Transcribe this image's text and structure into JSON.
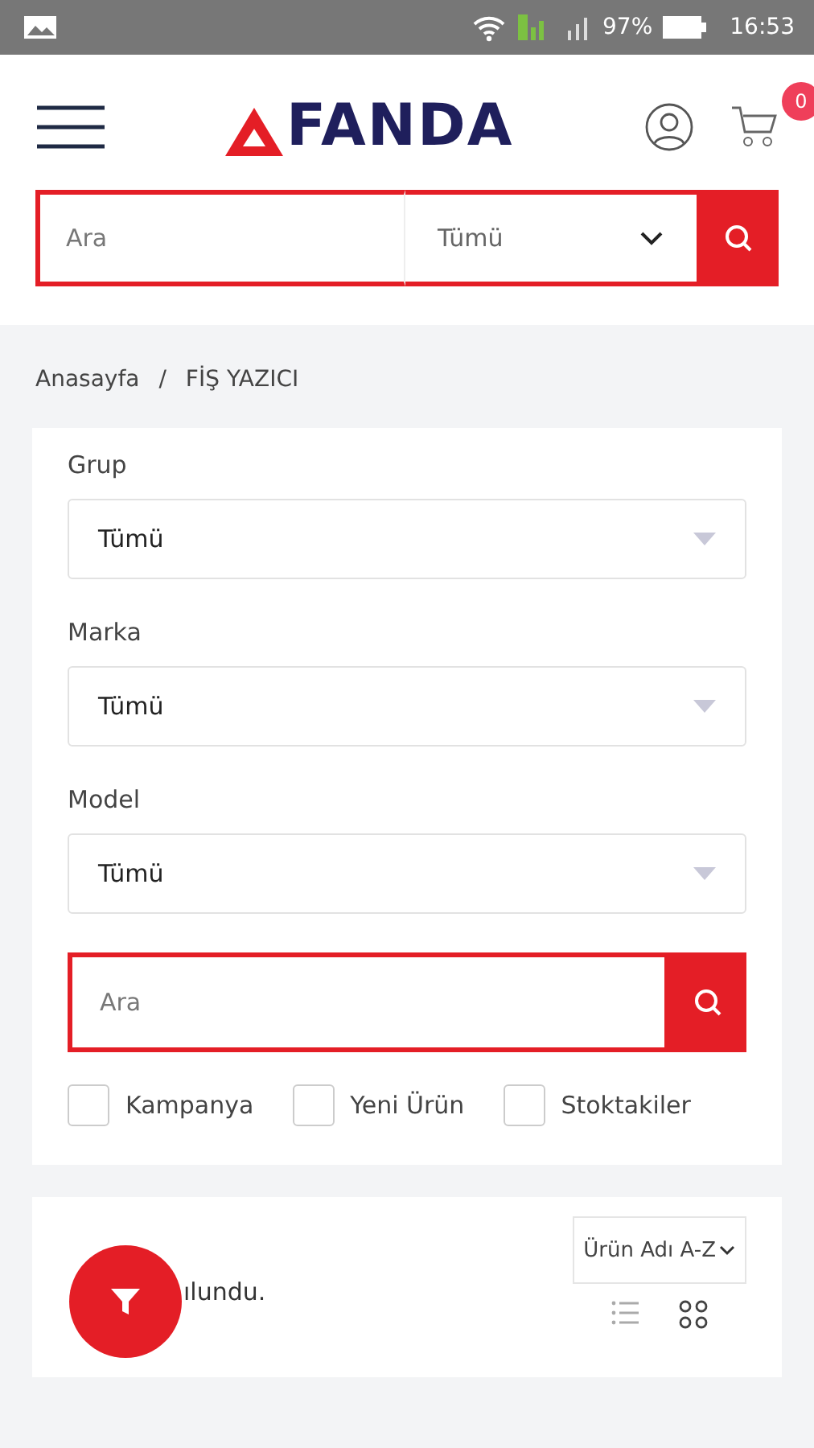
{
  "status_bar": {
    "battery": "97%",
    "time": "16:53"
  },
  "header": {
    "logo": "FANDA",
    "cart_count": "0"
  },
  "search": {
    "placeholder": "Ara",
    "category": "Tümü"
  },
  "breadcrumb": [
    {
      "label": "Anasayfa"
    },
    {
      "label": "FİŞ YAZICI"
    }
  ],
  "breadcrumb_separator": "/",
  "filters": [
    {
      "label": "Grup",
      "value": "Tümü"
    },
    {
      "label": "Marka",
      "value": "Tümü"
    },
    {
      "label": "Model",
      "value": "Tümü"
    }
  ],
  "filter_search": {
    "placeholder": "Ara"
  },
  "checkboxes": [
    {
      "label": "Kampanya",
      "checked": false
    },
    {
      "label": "Yeni Ürün",
      "checked": false
    },
    {
      "label": "Stoktakiler",
      "checked": false
    }
  ],
  "results": {
    "text": "ılundu.",
    "sort": "Ürün Adı A-Z",
    "views": [
      {
        "kind": "list",
        "selected": false
      },
      {
        "kind": "grid",
        "selected": true
      }
    ]
  }
}
